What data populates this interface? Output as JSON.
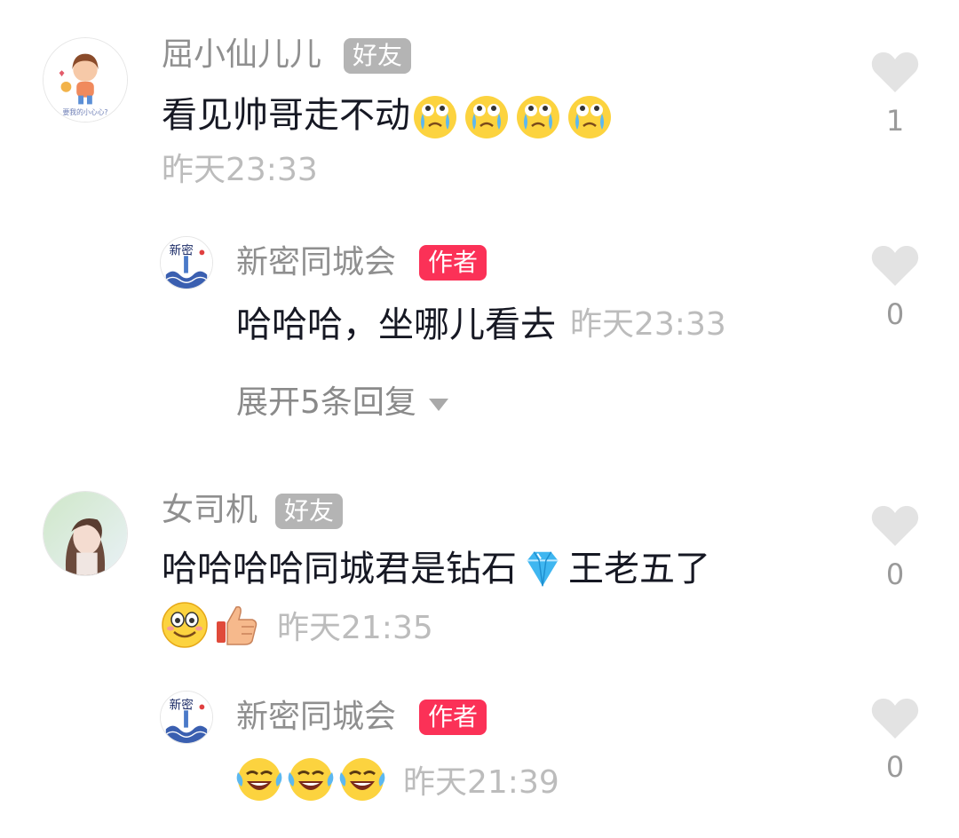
{
  "comments": [
    {
      "author": "屈小仙儿儿",
      "badge": "好友",
      "text": "看见帅哥走不动",
      "emojis": [
        "crying-emoji",
        "crying-emoji",
        "crying-emoji",
        "crying-emoji"
      ],
      "time": "昨天23:33",
      "likes": "1",
      "reply": {
        "author": "新密同城会",
        "badge": "作者",
        "text": "哈哈哈，坐哪儿看去",
        "time": "昨天23:33",
        "likes": "0"
      },
      "expand_label": "展开5条回复"
    },
    {
      "author": "女司机",
      "badge": "好友",
      "text_before": "哈哈哈哈同城君是钻石",
      "text_after": "王老五了",
      "inline_icon": "diamond-emoji",
      "emojis": [
        "smile-emoji",
        "thumbs-up-emoji"
      ],
      "time": "昨天21:35",
      "likes": "0",
      "reply": {
        "author": "新密同城会",
        "badge": "作者",
        "emojis": [
          "laugh-cry-emoji",
          "laugh-cry-emoji",
          "laugh-cry-emoji"
        ],
        "time": "昨天21:39",
        "likes": "0"
      }
    }
  ],
  "colors": {
    "author_badge": "#fb3157",
    "friend_badge": "#b4b4b4",
    "name": "#8f8f8f",
    "time": "#bcbcbc",
    "text": "#161823",
    "heart": "#e3e3e3"
  }
}
